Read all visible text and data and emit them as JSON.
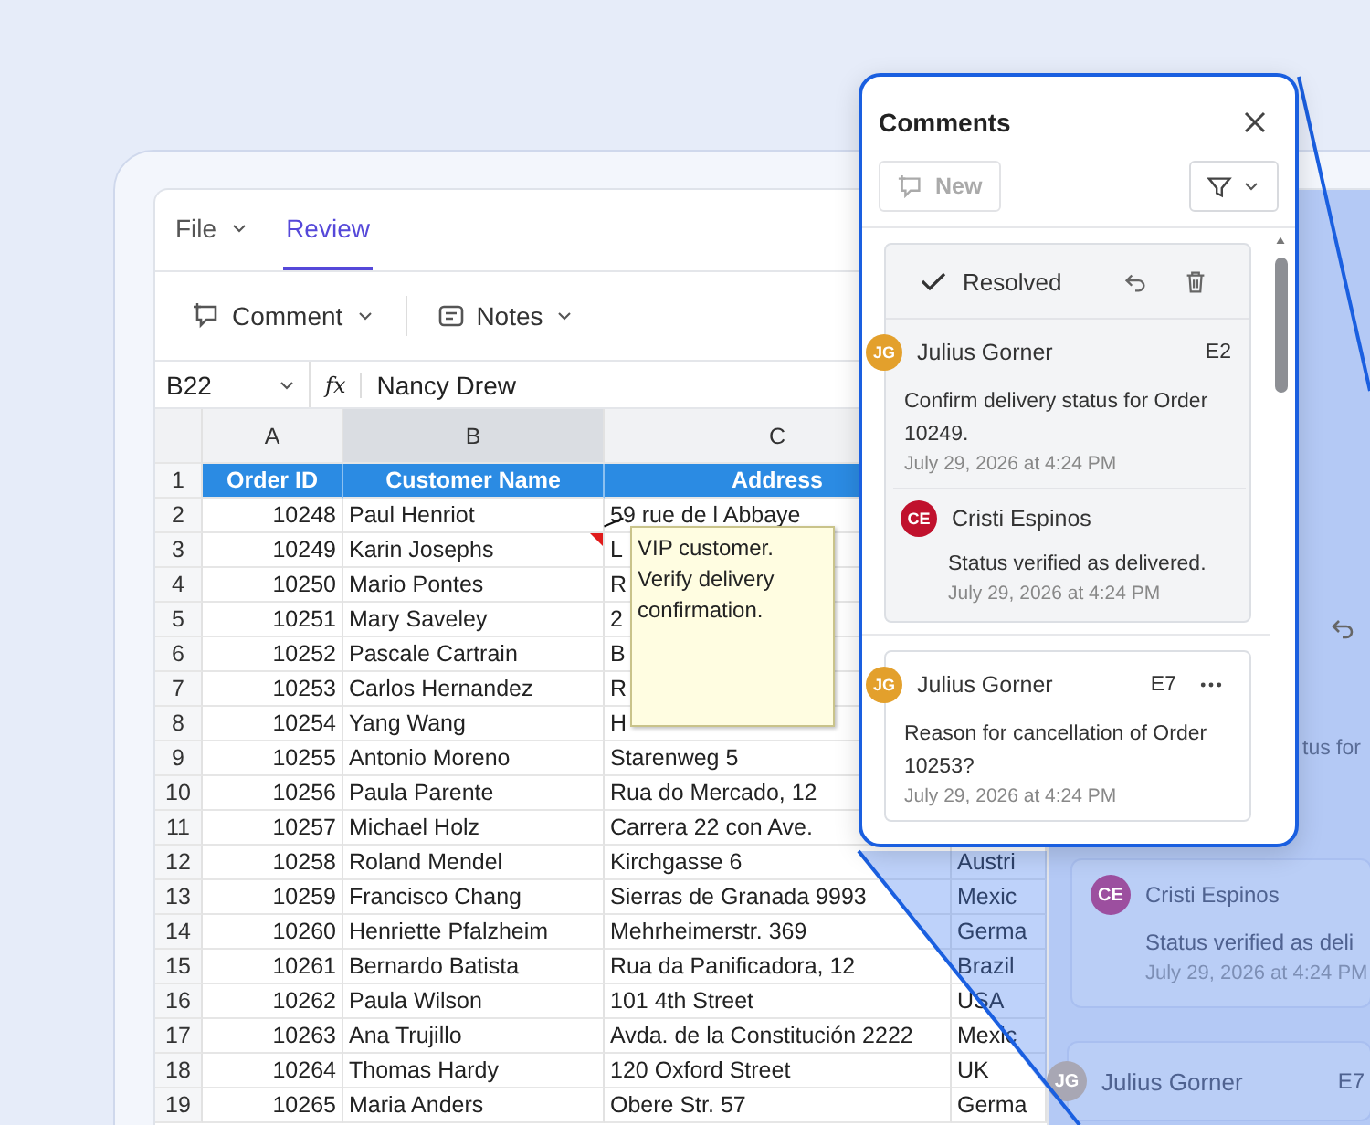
{
  "tabs": [
    {
      "label": "File",
      "selected": false,
      "dropdown": true
    },
    {
      "label": "Review",
      "selected": true,
      "dropdown": false
    }
  ],
  "toolbar": [
    {
      "kind": "comment",
      "label": "Comment"
    },
    {
      "kind": "notes",
      "label": "Notes"
    }
  ],
  "formula_bar": {
    "cell": "B22",
    "function_label": "fx",
    "value": "Nancy Drew"
  },
  "grid": {
    "columns": [
      {
        "label": "A",
        "selected": false
      },
      {
        "label": "B",
        "selected": true
      },
      {
        "label": "C",
        "selected": false
      }
    ],
    "rows": [
      {
        "number": "1",
        "kind": "header",
        "order_id": "Order ID",
        "customer": "Customer Name",
        "address": "Address"
      },
      {
        "number": "2",
        "order_id": "10248",
        "customer": "Paul Henriot",
        "address": "59 rue de l Abbaye"
      },
      {
        "number": "3",
        "order_id": "10249",
        "customer": "Karin Josephs",
        "address": "L",
        "has_note": true
      },
      {
        "number": "4",
        "order_id": "10250",
        "customer": "Mario Pontes",
        "address": "R"
      },
      {
        "number": "5",
        "order_id": "10251",
        "customer": "Mary Saveley",
        "address": "2"
      },
      {
        "number": "6",
        "order_id": "10252",
        "customer": "Pascale Cartrain",
        "address": "B"
      },
      {
        "number": "7",
        "order_id": "10253",
        "customer": "Carlos Hernandez",
        "address": "R"
      },
      {
        "number": "8",
        "order_id": "10254",
        "customer": "Yang Wang",
        "address": "H"
      },
      {
        "number": "9",
        "order_id": "10255",
        "customer": "Antonio Moreno",
        "address": "Starenweg 5"
      },
      {
        "number": "10",
        "order_id": "10256",
        "customer": "Paula Parente",
        "address": "Rua do Mercado, 12"
      },
      {
        "number": "11",
        "order_id": "10257",
        "customer": "Michael Holz",
        "address": "Carrera 22 con Ave."
      },
      {
        "number": "12",
        "order_id": "10258",
        "customer": "Roland Mendel",
        "address": "Kirchgasse 6",
        "column_4": "Austri"
      },
      {
        "number": "13",
        "order_id": "10259",
        "customer": "Francisco Chang",
        "address": "Sierras de Granada 9993",
        "column_4": "Mexic"
      },
      {
        "number": "14",
        "order_id": "10260",
        "customer": "Henriette Pfalzheim",
        "address": "Mehrheimerstr. 369",
        "column_4": "Germa"
      },
      {
        "number": "15",
        "order_id": "10261",
        "customer": "Bernardo Batista",
        "address": "Rua da Panificadora, 12",
        "column_4": "Brazil"
      },
      {
        "number": "16",
        "order_id": "10262",
        "customer": "Paula Wilson",
        "address": "101 4th Street",
        "column_4": "USA"
      },
      {
        "number": "17",
        "order_id": "10263",
        "customer": "Ana Trujillo",
        "address": "Avda. de la Constitución 2222",
        "column_4": "Mexic"
      },
      {
        "number": "18",
        "order_id": "10264",
        "customer": "Thomas Hardy",
        "address": "120 Oxford Street",
        "column_4": "UK"
      },
      {
        "number": "19",
        "order_id": "10265",
        "customer": "Maria Anders",
        "address": "Obere Str. 57",
        "column_4": "Germa"
      }
    ]
  },
  "note": {
    "text": "VIP customer. Verify delivery confirmation."
  },
  "background_comments": {
    "fragment": "tus for",
    "reply": {
      "initials": "CE",
      "name": "Cristi Espinos",
      "color": "#9c4f9f",
      "text": "Status verified as deli",
      "time": "July 29, 2026 at 4:24 PM"
    },
    "next": {
      "initials": "JG",
      "name": "Julius Gorner",
      "color": "#a8a7b4",
      "cell": "E7"
    }
  },
  "comments_popup": {
    "title": "Comments",
    "new_button": "New",
    "new_disabled": true,
    "threads": [
      {
        "resolved": true,
        "resolved_label": "Resolved",
        "initials": "JG",
        "author": "Julius Gorner",
        "color": "#e3a02c",
        "cell": "E2",
        "text": "Confirm delivery status for Order 10249.",
        "time": "July 29, 2026 at 4:24 PM",
        "replies": [
          {
            "initials": "CE",
            "author": "Cristi Espinos",
            "color": "#c0112d",
            "text": "Status verified as delivered.",
            "time": "July 29, 2026 at 4:24 PM"
          }
        ]
      },
      {
        "resolved": false,
        "initials": "JG",
        "author": "Julius Gorner",
        "color": "#e3a02c",
        "cell": "E7",
        "text": "Reason for cancellation of Order 10253?",
        "time": "July 29, 2026 at 4:24 PM"
      }
    ]
  }
}
